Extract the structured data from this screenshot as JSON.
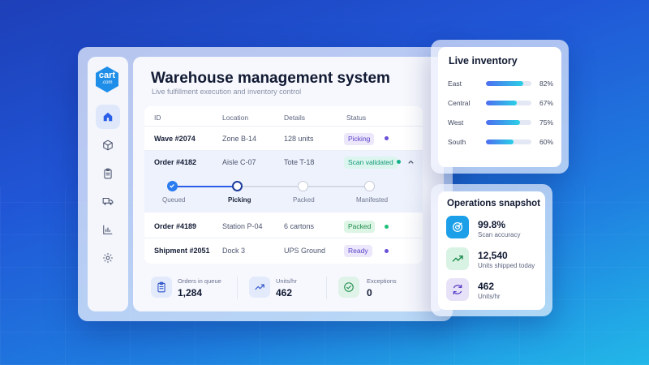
{
  "brand": {
    "logo_main": "cart",
    "logo_sub": ".com",
    "color": "#1f8ee8"
  },
  "header": {
    "title": "Warehouse management system",
    "subtitle": "Live fulfillment execution and inventory control"
  },
  "sidebar": {
    "items": [
      {
        "name": "home",
        "icon": "home-icon",
        "active": true
      },
      {
        "name": "inventory",
        "icon": "box-icon",
        "active": false
      },
      {
        "name": "orders",
        "icon": "clipboard-icon",
        "active": false
      },
      {
        "name": "shipping",
        "icon": "truck-icon",
        "active": false
      },
      {
        "name": "reports",
        "icon": "bar-chart-icon",
        "active": false
      },
      {
        "name": "settings",
        "icon": "gear-icon",
        "active": false
      }
    ]
  },
  "table": {
    "columns": [
      "ID",
      "Location",
      "Details",
      "Status"
    ],
    "rows": [
      {
        "id": "Wave #2074",
        "location": "Zone B-14",
        "details": "128 units",
        "status": "Picking",
        "status_color": "#6a4fd8"
      },
      {
        "id": "Order #4182",
        "location": "Aisle C-07",
        "details": "Tote T-18",
        "status": "Scan validated",
        "status_color": "#14b08a",
        "expanded": true
      },
      {
        "id": "Order #4189",
        "location": "Station P-04",
        "details": "6 cartons",
        "status": "Packed",
        "status_color": "#1f9a55"
      },
      {
        "id": "Shipment #2051",
        "location": "Dock 3",
        "details": "UPS Ground",
        "status": "Ready",
        "status_color": "#6a4fd8"
      }
    ],
    "steps": [
      {
        "label": "Queued",
        "state": "done"
      },
      {
        "label": "Picking",
        "state": "current"
      },
      {
        "label": "Packed",
        "state": "pending"
      },
      {
        "label": "Manifested",
        "state": "pending"
      }
    ]
  },
  "stats": [
    {
      "label": "Orders in queue",
      "value": "1,284",
      "icon": "clipboard-icon"
    },
    {
      "label": "Units/hr",
      "value": "462",
      "icon": "trend-up-icon"
    },
    {
      "label": "Exceptions",
      "value": "0",
      "icon": "check-circle-icon"
    }
  ],
  "inventory": {
    "title": "Live inventory",
    "items": [
      {
        "label": "East",
        "pct": "82%",
        "value": 82
      },
      {
        "label": "Central",
        "pct": "67%",
        "value": 67
      },
      {
        "label": "West",
        "pct": "75%",
        "value": 75
      },
      {
        "label": "South",
        "pct": "60%",
        "value": 60
      }
    ]
  },
  "snapshot": {
    "title": "Operations snapshot",
    "items": [
      {
        "value": "99.8%",
        "label": "Scan accuracy",
        "icon": "target-icon",
        "color": "#1a9fe8"
      },
      {
        "value": "12,540",
        "label": "Units shipped today",
        "icon": "trend-up-icon",
        "color": "#1fae6a"
      },
      {
        "value": "462",
        "label": "Units/hr",
        "icon": "refresh-icon",
        "color": "#6a4fd8"
      }
    ]
  }
}
